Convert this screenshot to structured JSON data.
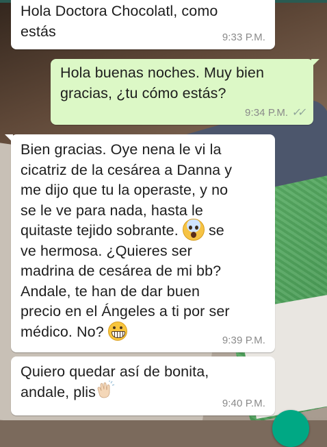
{
  "messages": [
    {
      "direction": "incoming",
      "lines": [
        "Hola Doctora Chocolatl, como",
        "estás"
      ],
      "time": "9:33 P.M."
    },
    {
      "direction": "outgoing",
      "lines": [
        "Hola buenas noches. Muy bien",
        "gracias, ¿tu cómo estás?"
      ],
      "time": "9:34 P.M.",
      "status_icon": "double-check-icon"
    },
    {
      "direction": "incoming",
      "lines": [
        "Bien gracias. Oye nena le vi la",
        "cicatriz de la cesárea a Danna y",
        "me dijo que tu la operaste, y no",
        "se le ve para nada, hasta le",
        "quitaste tejido sobrante.",
        "se",
        "ve hermosa. ¿Quieres ser",
        "madrina de cesárea de mi bb?",
        "Andale, te han de dar buen",
        "precio en el Ángeles a ti por ser",
        "médico. No?"
      ],
      "emojis": [
        "fearful-face-emoji",
        "grimacing-face-emoji"
      ],
      "time": "9:39 P.M."
    },
    {
      "direction": "incoming",
      "lines": [
        "Quiero quedar así de bonita,",
        "andale, plis"
      ],
      "emojis": [
        "clapping-hands-emoji"
      ],
      "time": "9:40 P.M."
    }
  ],
  "colors": {
    "incoming_bubble": "#ffffff",
    "outgoing_bubble": "#dcf8c6",
    "timestamp": "#8a8a8a",
    "fab": "#00a884"
  }
}
